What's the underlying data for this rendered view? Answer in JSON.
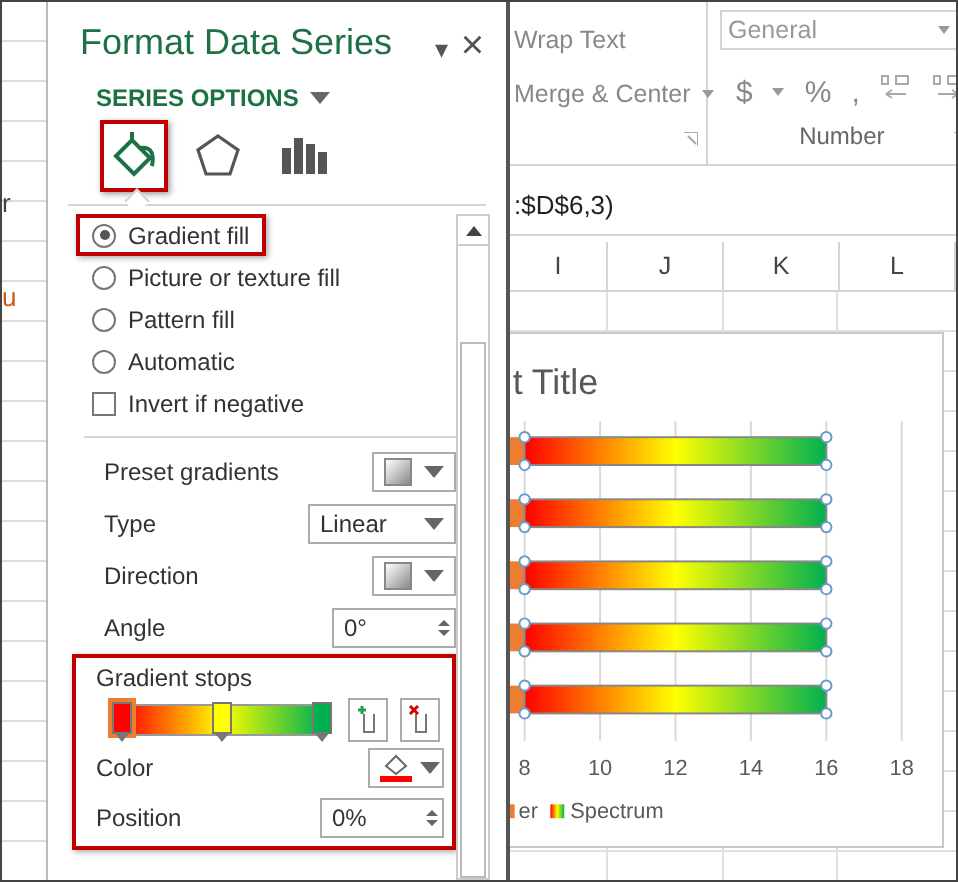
{
  "sheet_left": {
    "fragments": [
      "r",
      "u"
    ]
  },
  "pane": {
    "title": "Format Data Series",
    "menu_icon": "▾",
    "close": "×",
    "section": {
      "label": "SERIES OPTIONS"
    },
    "tabs": [
      {
        "kind": "fill",
        "selected": true,
        "highlighted": true
      },
      {
        "kind": "effects",
        "selected": false,
        "highlighted": false
      },
      {
        "kind": "options",
        "selected": false,
        "highlighted": false
      }
    ],
    "fill_options": [
      {
        "label": "Gradient fill",
        "selected": true,
        "highlighted": true
      },
      {
        "label": "Picture or texture fill",
        "selected": false,
        "highlighted": false
      },
      {
        "label": "Pattern fill",
        "selected": false,
        "highlighted": false
      },
      {
        "label": "Automatic",
        "selected": false,
        "highlighted": false
      }
    ],
    "invert": {
      "label": "Invert if negative",
      "checked": false
    },
    "settings": [
      {
        "kind": "swatch",
        "label": "Preset gradients"
      },
      {
        "kind": "dropdown",
        "label": "Type",
        "value": "Linear"
      },
      {
        "kind": "swatch",
        "label": "Direction"
      },
      {
        "kind": "spinner",
        "label": "Angle",
        "value": "0°"
      }
    ],
    "gradient_stops": {
      "label": "Gradient stops",
      "highlighted": true,
      "stops": [
        {
          "color": "#ff0000",
          "level": 0,
          "selected": true
        },
        {
          "color": "#ffff00",
          "level": 0.5,
          "selected": false
        },
        {
          "color": "#00b050",
          "level": 1,
          "selected": false
        }
      ],
      "color": {
        "label": "Color"
      },
      "position": {
        "label": "Position",
        "value": "0%"
      }
    }
  },
  "ribbon": {
    "alignment": [
      {
        "label": "Wrap Text"
      },
      {
        "label": "Merge & Center"
      }
    ],
    "number_format": "General",
    "number_symbols": [
      "$",
      "%",
      ","
    ],
    "number_group": "Number"
  },
  "formula_bar": {
    "text": ":$D$6,3)"
  },
  "columns": [
    "I",
    "J",
    "K",
    "L"
  ],
  "chart": {
    "title": "t Title",
    "chart_data": {
      "type": "bar",
      "orientation": "horizontal",
      "stacked": true,
      "series": [
        {
          "name": "er",
          "color": "#ed7d31",
          "values": [
            8,
            8,
            8,
            8,
            8
          ]
        },
        {
          "name": "Spectrum",
          "values": [
            8,
            8,
            8,
            8,
            8
          ]
        }
      ],
      "xlim": [
        7.63,
        19.05
      ],
      "xticks": [
        8,
        10,
        12,
        14,
        16,
        18
      ],
      "grid": true,
      "legend": "bottom"
    }
  }
}
